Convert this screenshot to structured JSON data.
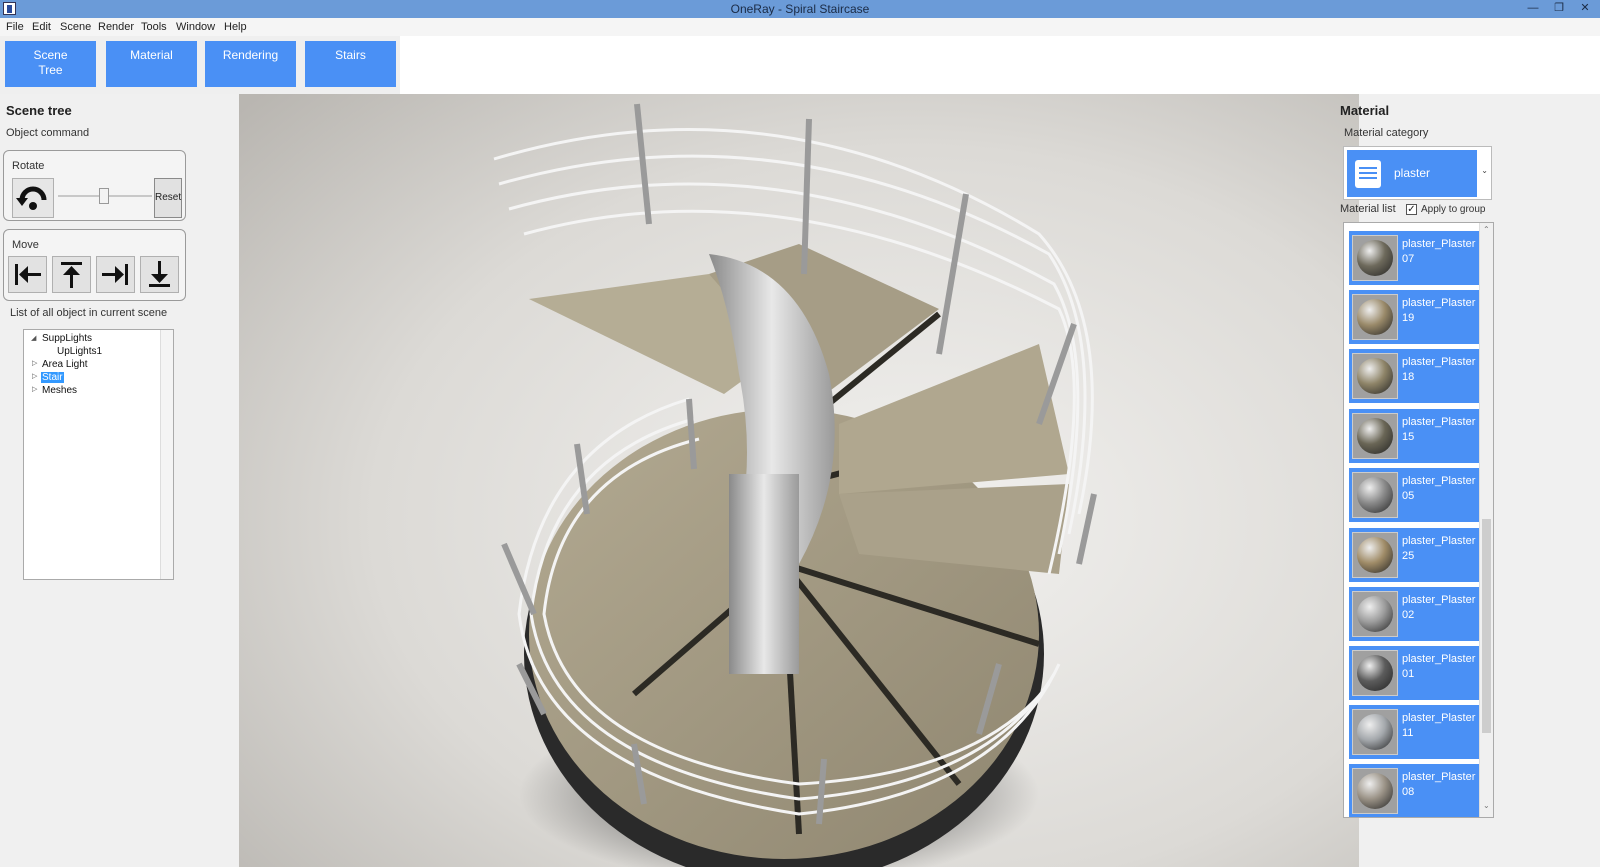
{
  "window": {
    "title": "OneRay - Spiral Staircase"
  },
  "menu": [
    "File",
    "Edit",
    "Scene",
    "Render",
    "Tools",
    "Window",
    "Help"
  ],
  "ribbon": {
    "buttons": [
      {
        "label": "Scene Tree"
      },
      {
        "label": "Material"
      },
      {
        "label": "Rendering"
      },
      {
        "label": "Stairs"
      }
    ],
    "accent": "#4a90f5"
  },
  "left": {
    "title": "Scene tree",
    "object_command": "Object command",
    "rotate_label": "Rotate",
    "reset_label": "Reset",
    "move_label": "Move",
    "list_label": "List of all object in current scene",
    "tree": [
      {
        "label": "SuppLights",
        "expanded": true
      },
      {
        "label": "UpLights1",
        "child": true
      },
      {
        "label": "Area Light"
      },
      {
        "label": "Stair",
        "selected": true
      },
      {
        "label": "Meshes"
      }
    ]
  },
  "right": {
    "title": "Material",
    "category_label": "Material category",
    "category_value": "plaster",
    "list_label": "Material list",
    "apply_to_group": "Apply to group",
    "apply_checked": true,
    "materials": [
      {
        "name": "plaster_Plaster07",
        "color": "#6e6a5c"
      },
      {
        "name": "plaster_Plaster19",
        "color": "#9a8a6a"
      },
      {
        "name": "plaster_Plaster18",
        "color": "#8e8468"
      },
      {
        "name": "plaster_Plaster15",
        "color": "#6a6656"
      },
      {
        "name": "plaster_Plaster05",
        "color": "#8a8a8a"
      },
      {
        "name": "plaster_Plaster25",
        "color": "#a08c68"
      },
      {
        "name": "plaster_Plaster02",
        "color": "#9c9c9c"
      },
      {
        "name": "plaster_Plaster01",
        "color": "#5c5c5c"
      },
      {
        "name": "plaster_Plaster11",
        "color": "#a4a8ac"
      },
      {
        "name": "plaster_Plaster08",
        "color": "#9a9286"
      }
    ]
  }
}
